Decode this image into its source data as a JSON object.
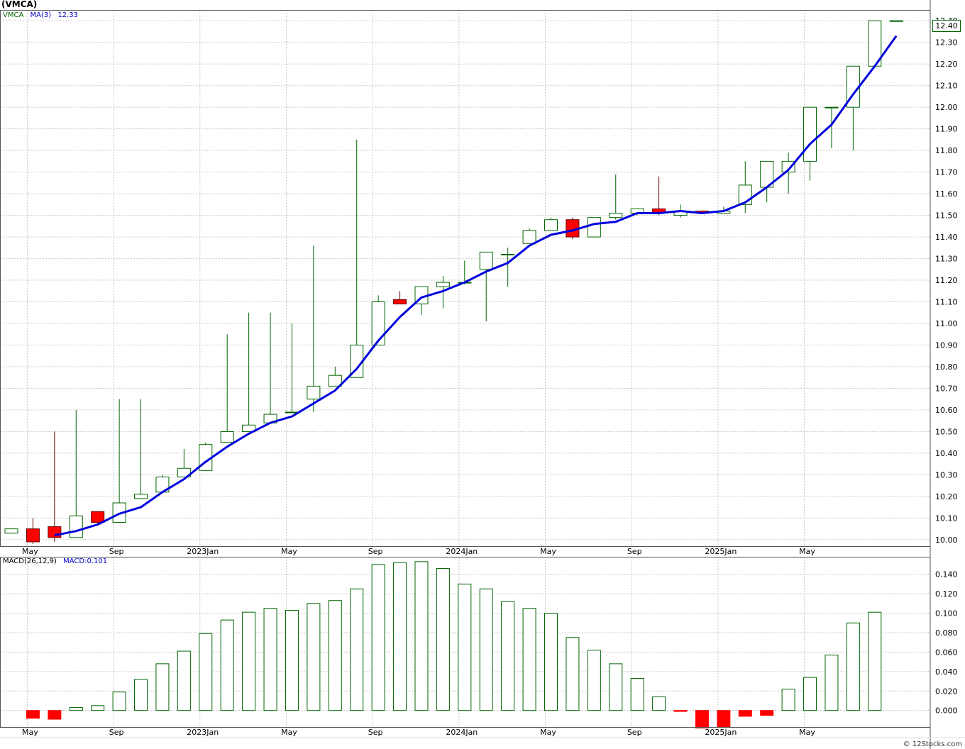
{
  "title": "(VMCA)",
  "legend": {
    "symbol": "VMCA",
    "ma_label": "MA(3)",
    "ma_value": "12.33",
    "macd_name": "MACD(26,12,9)",
    "macd_value": "MACD:0.101"
  },
  "last_price": "12.40",
  "footer": "© 12Stocks.com",
  "colors": {
    "up": "#006400",
    "down": "#ff0000",
    "ma": "#0000dd",
    "grid": "#c8c8c8"
  },
  "chart_data": [
    {
      "type": "candlestick",
      "name": "price",
      "x_tick_labels": [
        "May",
        "Sep",
        "2023Jan",
        "May",
        "Sep",
        "2024Jan",
        "May",
        "Sep",
        "2025Jan",
        "May"
      ],
      "x_tick_index": [
        1,
        5,
        9,
        13,
        17,
        21,
        25,
        29,
        33,
        37
      ],
      "y_ticks": [
        10.0,
        10.1,
        10.2,
        10.3,
        10.4,
        10.5,
        10.6,
        10.7,
        10.8,
        10.9,
        11.0,
        11.1,
        11.2,
        11.3,
        11.4,
        11.5,
        11.6,
        11.7,
        11.8,
        11.9,
        12.0,
        12.1,
        12.2,
        12.3,
        12.4
      ],
      "ylim": [
        9.97,
        12.45
      ],
      "candles": [
        {
          "o": 10.03,
          "h": 10.05,
          "l": 10.03,
          "c": 10.05
        },
        {
          "o": 10.05,
          "h": 10.1,
          "l": 9.98,
          "c": 9.99
        },
        {
          "o": 10.06,
          "h": 10.5,
          "l": 9.99,
          "c": 10.01
        },
        {
          "o": 10.01,
          "h": 10.6,
          "l": 10.01,
          "c": 10.11
        },
        {
          "o": 10.13,
          "h": 10.13,
          "l": 10.07,
          "c": 10.08
        },
        {
          "o": 10.08,
          "h": 10.65,
          "l": 10.08,
          "c": 10.17
        },
        {
          "o": 10.19,
          "h": 10.65,
          "l": 10.19,
          "c": 10.21
        },
        {
          "o": 10.22,
          "h": 10.3,
          "l": 10.22,
          "c": 10.29
        },
        {
          "o": 10.29,
          "h": 10.42,
          "l": 10.29,
          "c": 10.33
        },
        {
          "o": 10.32,
          "h": 10.45,
          "l": 10.32,
          "c": 10.44
        },
        {
          "o": 10.45,
          "h": 10.95,
          "l": 10.45,
          "c": 10.5
        },
        {
          "o": 10.5,
          "h": 11.05,
          "l": 10.5,
          "c": 10.53
        },
        {
          "o": 10.54,
          "h": 11.05,
          "l": 10.54,
          "c": 10.58
        },
        {
          "o": 10.59,
          "h": 11.0,
          "l": 10.59,
          "c": 10.59
        },
        {
          "o": 10.65,
          "h": 11.36,
          "l": 10.59,
          "c": 10.71
        },
        {
          "o": 10.71,
          "h": 10.8,
          "l": 10.71,
          "c": 10.76
        },
        {
          "o": 10.75,
          "h": 11.85,
          "l": 10.75,
          "c": 10.9
        },
        {
          "o": 10.9,
          "h": 11.13,
          "l": 10.9,
          "c": 11.1
        },
        {
          "o": 11.11,
          "h": 11.15,
          "l": 11.09,
          "c": 11.09
        },
        {
          "o": 11.09,
          "h": 11.17,
          "l": 11.04,
          "c": 11.17
        },
        {
          "o": 11.17,
          "h": 11.22,
          "l": 11.07,
          "c": 11.19
        },
        {
          "o": 11.19,
          "h": 11.29,
          "l": 11.18,
          "c": 11.19
        },
        {
          "o": 11.25,
          "h": 11.33,
          "l": 11.01,
          "c": 11.33
        },
        {
          "o": 11.32,
          "h": 11.35,
          "l": 11.17,
          "c": 11.32
        },
        {
          "o": 11.37,
          "h": 11.44,
          "l": 11.37,
          "c": 11.43
        },
        {
          "o": 11.43,
          "h": 11.49,
          "l": 11.43,
          "c": 11.48
        },
        {
          "o": 11.48,
          "h": 11.49,
          "l": 11.39,
          "c": 11.4
        },
        {
          "o": 11.4,
          "h": 11.49,
          "l": 11.4,
          "c": 11.49
        },
        {
          "o": 11.49,
          "h": 11.69,
          "l": 11.48,
          "c": 11.51
        },
        {
          "o": 11.51,
          "h": 11.53,
          "l": 11.5,
          "c": 11.53
        },
        {
          "o": 11.53,
          "h": 11.68,
          "l": 11.5,
          "c": 11.51
        },
        {
          "o": 11.5,
          "h": 11.55,
          "l": 11.49,
          "c": 11.52
        },
        {
          "o": 11.52,
          "h": 11.52,
          "l": 11.51,
          "c": 11.51
        },
        {
          "o": 11.51,
          "h": 11.54,
          "l": 11.51,
          "c": 11.52
        },
        {
          "o": 11.55,
          "h": 11.75,
          "l": 11.51,
          "c": 11.64
        },
        {
          "o": 11.63,
          "h": 11.75,
          "l": 11.56,
          "c": 11.75
        },
        {
          "o": 11.7,
          "h": 11.79,
          "l": 11.6,
          "c": 11.75
        },
        {
          "o": 11.75,
          "h": 12.0,
          "l": 11.66,
          "c": 12.0
        },
        {
          "o": 12.0,
          "h": 12.0,
          "l": 11.81,
          "c": 12.0
        },
        {
          "o": 12.0,
          "h": 12.19,
          "l": 11.8,
          "c": 12.19
        },
        {
          "o": 12.19,
          "h": 12.4,
          "l": 12.19,
          "c": 12.4
        },
        {
          "o": 12.4,
          "h": 12.4,
          "l": 12.4,
          "c": 12.4
        }
      ],
      "ma": [
        null,
        null,
        10.02,
        10.04,
        10.07,
        10.12,
        10.15,
        10.22,
        10.28,
        10.36,
        10.43,
        10.49,
        10.54,
        10.57,
        10.63,
        10.69,
        10.79,
        10.92,
        11.03,
        11.12,
        11.15,
        11.19,
        11.24,
        11.28,
        11.36,
        11.41,
        11.43,
        11.46,
        11.47,
        11.51,
        11.51,
        11.52,
        11.51,
        11.52,
        11.56,
        11.63,
        11.71,
        11.83,
        11.92,
        12.06,
        12.19,
        12.33
      ]
    },
    {
      "type": "bar",
      "name": "MACD",
      "x_tick_labels": [
        "May",
        "Sep",
        "2023Jan",
        "May",
        "Sep",
        "2024Jan",
        "May",
        "Sep",
        "2025Jan",
        "May"
      ],
      "x_tick_index": [
        1,
        5,
        9,
        13,
        17,
        21,
        25,
        29,
        33,
        37
      ],
      "y_ticks": [
        0.0,
        0.02,
        0.04,
        0.06,
        0.08,
        0.1,
        0.12,
        0.14
      ],
      "ylim": [
        -0.017,
        0.158
      ],
      "values": [
        null,
        -0.008,
        -0.009,
        0.003,
        0.005,
        0.019,
        0.032,
        0.048,
        0.061,
        0.079,
        0.093,
        0.101,
        0.105,
        0.103,
        0.11,
        0.113,
        0.125,
        0.15,
        0.152,
        0.153,
        0.146,
        0.13,
        0.125,
        0.112,
        0.105,
        0.1,
        0.075,
        0.062,
        0.048,
        0.033,
        0.014,
        -0.001,
        -0.018,
        -0.017,
        -0.006,
        -0.005,
        0.022,
        0.034,
        0.057,
        0.09,
        0.101
      ]
    }
  ]
}
